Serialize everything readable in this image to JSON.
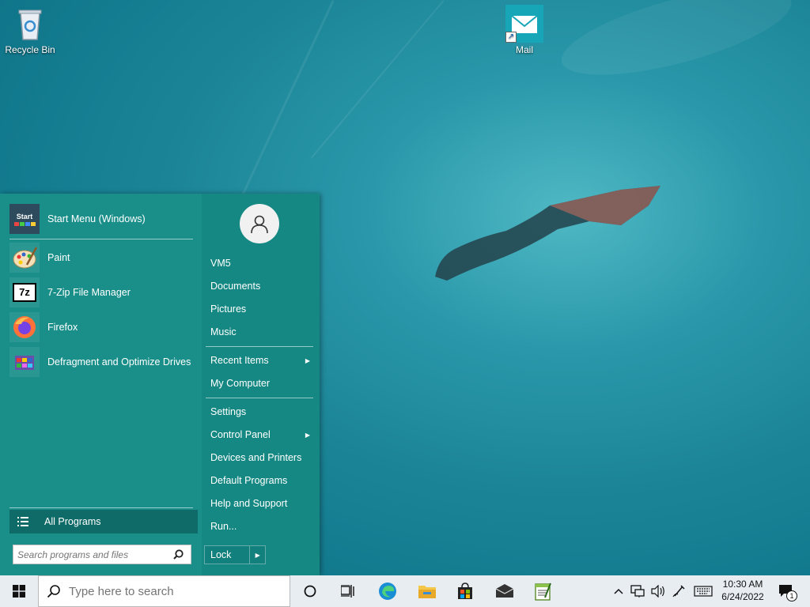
{
  "desktop": {
    "icons": [
      {
        "label": "Recycle Bin"
      },
      {
        "label": "Mail"
      }
    ]
  },
  "start_menu": {
    "pinned": [
      {
        "label": "Start Menu (Windows)",
        "icon": "start-menu-icon"
      }
    ],
    "recent": [
      {
        "label": "Paint",
        "icon": "paint-icon"
      },
      {
        "label": "7-Zip File Manager",
        "icon": "7zip-icon"
      },
      {
        "label": "Firefox",
        "icon": "firefox-icon"
      },
      {
        "label": "Defragment and Optimize Drives",
        "icon": "defrag-icon"
      }
    ],
    "all_programs_label": "All Programs",
    "search_placeholder": "Search programs and files",
    "user_name": "VM5",
    "right_items": {
      "documents": "Documents",
      "pictures": "Pictures",
      "music": "Music",
      "recent_items": "Recent Items",
      "my_computer": "My Computer",
      "settings": "Settings",
      "control_panel": "Control Panel",
      "devices_printers": "Devices and Printers",
      "default_programs": "Default Programs",
      "help_support": "Help and Support",
      "run": "Run..."
    },
    "lock_label": "Lock",
    "start_icon_text": "Start"
  },
  "taskbar": {
    "search_placeholder": "Type here to search",
    "apps": [
      "cortana-icon",
      "task-view-icon",
      "edge-icon",
      "file-explorer-icon",
      "store-icon",
      "mail-icon",
      "notepad-icon"
    ],
    "time": "10:30 AM",
    "date": "6/24/2022",
    "notification_count": "1"
  },
  "colors": {
    "start_menu_bg": "#1a8f8a",
    "taskbar_bg": "#e8edf2"
  }
}
